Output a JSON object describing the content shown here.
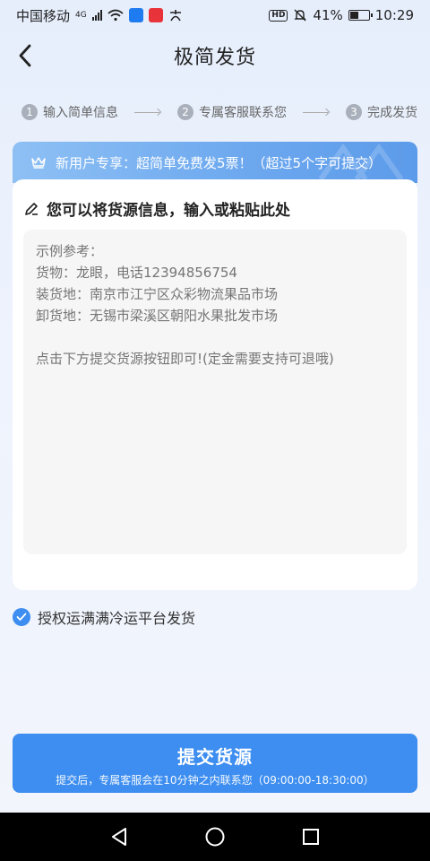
{
  "status_bar": {
    "carrier": "中国移动",
    "network": "4G",
    "battery": "41%",
    "time": "10:29",
    "hd": "HD"
  },
  "header": {
    "title": "极简发货"
  },
  "steps": [
    {
      "num": "1",
      "label": "输入简单信息"
    },
    {
      "num": "2",
      "label": "专属客服联系您"
    },
    {
      "num": "3",
      "label": "完成发货"
    }
  ],
  "promo": {
    "text": "新用户专享：超简单免费发5票！（超过5个字可提交）"
  },
  "card": {
    "heading": "您可以将货源信息，输入或粘贴此处",
    "placeholder": "示例参考：\n货物：龙眼，电话12394856754\n装货地：南京市江宁区众彩物流果品市场\n卸货地：无锡市梁溪区朝阳水果批发市场\n\n点击下方提交货源按钮即可!(定金需要支持可退哦)"
  },
  "auth": {
    "label": "授权运满满冷运平台发货",
    "checked": true
  },
  "submit": {
    "title": "提交货源",
    "subtitle": "提交后，专属客服会在10分钟之内联系您（09:00:00-18:30:00）"
  },
  "colors": {
    "accent": "#3d8ef0",
    "step_num": "#a9b0bb"
  }
}
